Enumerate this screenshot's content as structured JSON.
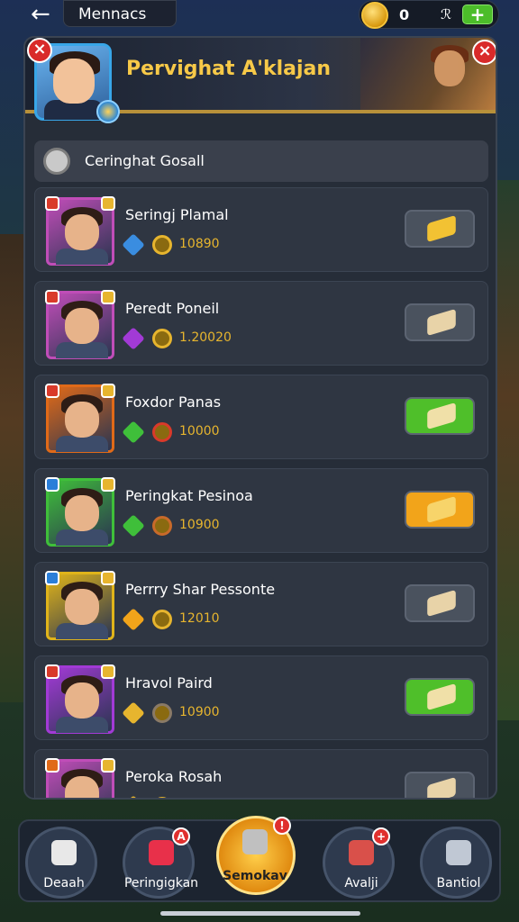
{
  "topbar": {
    "back_icon": "←",
    "title": "Mennacs",
    "currency_value": "0",
    "currency_symbol": "ℛ",
    "add_label": "+"
  },
  "header": {
    "title": "Pervighat A'klajan",
    "close_label": "×"
  },
  "section": {
    "label": "Ceringhat Gosall"
  },
  "rows": [
    {
      "name": "Seringj Plamal",
      "value": "10890",
      "frame": "#c04db8",
      "gem": "#3a8de0",
      "ring": "#e7b52e",
      "action_color": "#4a525e",
      "icon_color": "#f2c233",
      "mini": "#d93a2a"
    },
    {
      "name": "Peredt Poneil",
      "value": "1.20020",
      "frame": "#c04db8",
      "gem": "#a23ad6",
      "ring": "#e7b52e",
      "action_color": "#4a525e",
      "icon_color": "#e8d3a8",
      "mini": "#d93a2a"
    },
    {
      "name": "Foxdor Panas",
      "value": "10000",
      "frame": "#e06a18",
      "gem": "#3fbf3a",
      "ring": "#d93a2a",
      "action_color": "#4fbf2a",
      "icon_color": "#f0e0a8",
      "mini": "#d93a2a"
    },
    {
      "name": "Peringkat Pesinoa",
      "value": "10900",
      "frame": "#3fbf3a",
      "gem": "#3fbf3a",
      "ring": "#c86a2a",
      "action_color": "#f2a41a",
      "icon_color": "#f7d46a",
      "mini": "#2a7ed9"
    },
    {
      "name": "Perrry Shar Pessonte",
      "value": "12010",
      "frame": "#e0b41a",
      "gem": "#f2a41a",
      "ring": "#e7b52e",
      "action_color": "#4a525e",
      "icon_color": "#e8d3a8",
      "mini": "#2a7ed9"
    },
    {
      "name": "Hravol Paird",
      "value": "10900",
      "frame": "#a23ad6",
      "gem": "#e7b52e",
      "ring": "#8a7a66",
      "action_color": "#4fbf2a",
      "icon_color": "#f0e0a8",
      "mini": "#d93a2a"
    },
    {
      "name": "Peroka Rosah",
      "value": "",
      "frame": "#c04db8",
      "gem": "#e7b52e",
      "ring": "#e7b52e",
      "action_color": "#4a525e",
      "icon_color": "#e8d3a8",
      "mini": "#e06a18"
    }
  ],
  "nav": [
    {
      "label": "Deaah",
      "badge": ""
    },
    {
      "label": "Peringigkan",
      "badge": "A"
    },
    {
      "label": "Semokav",
      "badge": "!"
    },
    {
      "label": "Avalji",
      "badge": "+"
    },
    {
      "label": "Bantiol",
      "badge": ""
    }
  ]
}
